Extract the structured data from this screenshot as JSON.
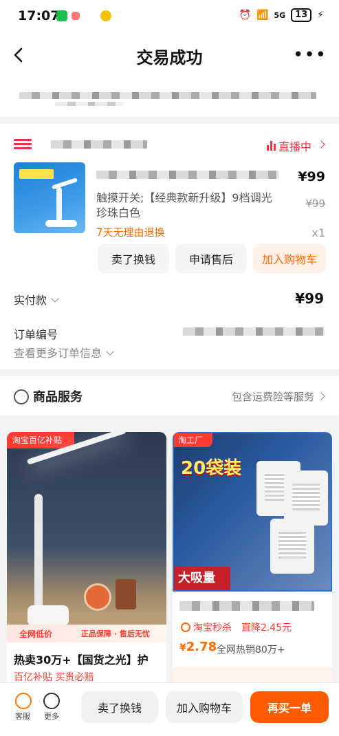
{
  "status_bar": {
    "time": "17:07",
    "network": "5G",
    "battery": "13"
  },
  "header": {
    "title": "交易成功"
  },
  "shop": {
    "live_label": "直播中"
  },
  "item": {
    "description": "触摸开关;【经典款新升级】9档调光珍珠白色",
    "return_policy": "7天无理由退换",
    "price": "¥99",
    "original_price": "¥99",
    "quantity": "x1",
    "actions": {
      "sell": "卖了换钱",
      "after_sale": "申请售后",
      "add_cart": "加入购物车"
    }
  },
  "order": {
    "paid_label": "实付款",
    "paid_amount": "¥99",
    "number_label": "订单编号",
    "more_info": "查看更多订单信息"
  },
  "service": {
    "title": "商品服务",
    "summary": "包含运费险等服务"
  },
  "recommendations": [
    {
      "corner_tag": "淘宝百亿补贴",
      "badge_left": "全网低价",
      "badge_right": "正品保障 · 售后无忧",
      "title": "热卖30万+【国货之光】护",
      "subtitle": "百亿补贴  买贵必赔"
    },
    {
      "corner_tag": "淘工厂",
      "headline": "20袋装",
      "badge": "大吸量",
      "flash_label": "淘宝秒杀",
      "discount": "直降2.45元",
      "price_symbol": "¥",
      "price": "2.78",
      "sold": "全网热销80万+"
    }
  ],
  "bottom_bar": {
    "service_label": "客服",
    "more_label": "更多",
    "sell": "卖了换钱",
    "add_cart": "加入购物车",
    "rebuy": "再买一单"
  }
}
